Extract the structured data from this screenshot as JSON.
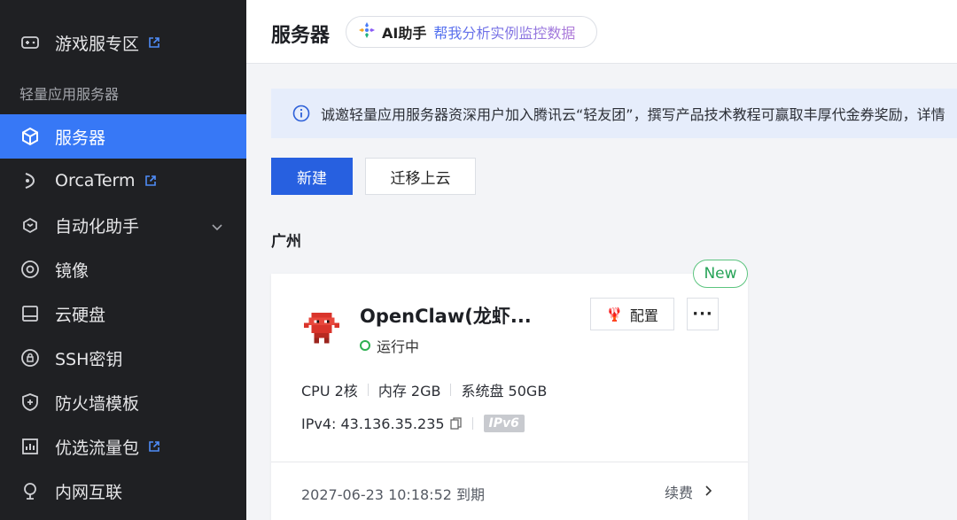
{
  "sidebar": {
    "section_label": "轻量应用服务器",
    "items": [
      {
        "label": "游戏服专区",
        "icon": "gamepad-icon",
        "external": true
      },
      {
        "label": "服务器",
        "icon": "cube-icon",
        "active": true
      },
      {
        "label": "OrcaTerm",
        "icon": "terminal-icon",
        "external": true
      },
      {
        "label": "自动化助手",
        "icon": "automation-icon",
        "expandable": true
      },
      {
        "label": "镜像",
        "icon": "image-disc-icon"
      },
      {
        "label": "云硬盘",
        "icon": "disk-icon"
      },
      {
        "label": "SSH密钥",
        "icon": "key-icon"
      },
      {
        "label": "防火墙模板",
        "icon": "shield-icon"
      },
      {
        "label": "优选流量包",
        "icon": "traffic-icon",
        "external": true
      },
      {
        "label": "内网互联",
        "icon": "network-icon"
      }
    ]
  },
  "header": {
    "title": "服务器",
    "ai_name": "AI助手",
    "ai_hint": "帮我分析实例监控数据"
  },
  "notice": {
    "text": "诚邀轻量应用服务器资深用户加入腾讯云“轻友团”，撰写产品技术教程可赢取丰厚代金券奖励，详情"
  },
  "actions": {
    "create_label": "新建",
    "migrate_label": "迁移上云"
  },
  "region": "广州",
  "instance": {
    "badge": "New",
    "name": "OpenClaw(龙虾...",
    "status": "运行中",
    "config_label": "配置",
    "more_label": "···",
    "cpu": "CPU 2核",
    "memory": "内存 2GB",
    "disk": "系统盘 50GB",
    "ipv4": "IPv4: 43.136.35.235",
    "ipv6_badge": "IPv6",
    "expire": "2027-06-23 10:18:52 到期",
    "renew_label": "续费"
  },
  "colors": {
    "sidebar_bg": "#1f2023",
    "active": "#3778f6",
    "primary": "#2760e0",
    "running": "#2fb052",
    "new_badge": "#27a358"
  }
}
